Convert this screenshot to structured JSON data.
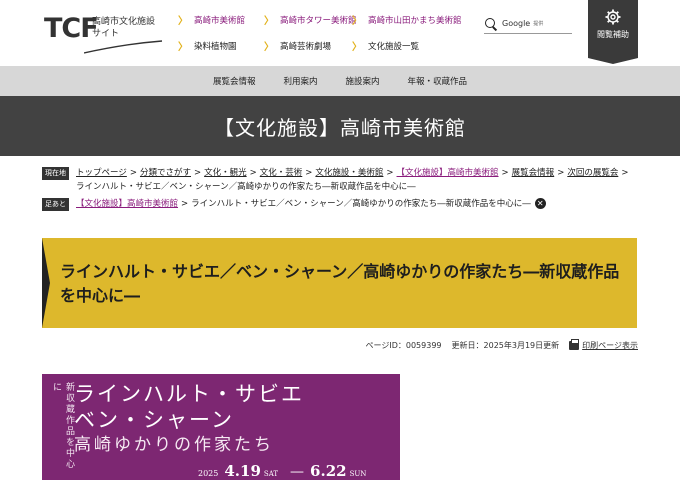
{
  "header": {
    "logo_mark": "TCF",
    "logo_text": "高崎市文化施設\nサイト",
    "nav": [
      {
        "label": "高崎市美術館",
        "highlight": true
      },
      {
        "label": "高崎市タワー美術館",
        "highlight": true
      },
      {
        "label": "高崎市山田かまち美術館",
        "highlight": true
      },
      {
        "label": "染料植物園",
        "highlight": false
      },
      {
        "label": "高崎芸術劇場",
        "highlight": false
      },
      {
        "label": "文化施設一覧",
        "highlight": false
      }
    ],
    "search_label": "Google",
    "search_sub": "提供",
    "assist_label": "閲覧補助"
  },
  "subnav": [
    "展覧会情報",
    "利用案内",
    "施設案内",
    "年報・収蔵作品"
  ],
  "site_title": "【文化施設】高崎市美術館",
  "breadcrumb": {
    "current_tag": "現在地",
    "items": [
      {
        "label": "トップページ",
        "link": true
      },
      {
        "label": "分類でさがす",
        "link": true
      },
      {
        "label": "文化・観光",
        "link": true
      },
      {
        "label": "文化・芸術",
        "link": true
      },
      {
        "label": "文化施設・美術館",
        "link": true
      },
      {
        "label": "【文化施設】高崎市美術館",
        "link": true,
        "purple": true
      },
      {
        "label": "展覧会情報",
        "link": true
      },
      {
        "label": "次回の展覧会",
        "link": true
      },
      {
        "label": "ラインハルト・サビエ／ベン・シャーン／高崎ゆかりの作家たち―新収蔵作品を中心に―",
        "link": false
      }
    ],
    "footprint_tag": "足あと",
    "footprint_link": "【文化施設】高崎市美術館",
    "footprint_current": "ラインハルト・サビエ／ベン・シャーン／高崎ゆかりの作家たち―新収蔵作品を中心に―",
    "close_glyph": "✕"
  },
  "heading": "ラインハルト・サビエ／ベン・シャーン／高崎ゆかりの作家たち―新収蔵作品を中心に―",
  "meta": {
    "page_id": "ページID：0059399",
    "updated": "更新日：2025年3月19日更新",
    "print_label": "印刷ページ表示"
  },
  "poster": {
    "vertical": "新収蔵作品を中心に",
    "line1": "ラインハルト・サビエ",
    "line2": "ベン・シャーン",
    "line3": "高崎ゆかりの作家たち",
    "year": "2025",
    "start": "4.19",
    "start_dow": "SAT",
    "dash": "—",
    "end": "6.22",
    "end_dow": "SUN"
  },
  "colors": {
    "accent_yellow": "#ddb82c",
    "dark_band": "#424242",
    "poster_purple": "#7d2772",
    "link_purple": "#8a1c7c"
  }
}
